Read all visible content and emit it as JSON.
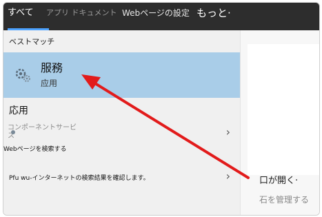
{
  "tabs": {
    "all": "すべて",
    "apps": "アプリ ドキュメント",
    "web": "Webページの設定",
    "more": "もっと·"
  },
  "sections": {
    "best_match": "ベストマッチ",
    "apps": "応用"
  },
  "best_match": {
    "title": "服務",
    "subtitle": "应用",
    "icon": "gear-icon"
  },
  "results": {
    "control_panel": "コンポーネントサービス",
    "web_search": "Webページを検索する",
    "pfu": "Pfu wu-インターネットの検索結果を確認します。"
  },
  "right_panel": {
    "open": "口が開く·",
    "manage": "石を管理する"
  },
  "colors": {
    "highlight": "#a9cde8",
    "tab_accent": "#4da3ff",
    "annotation_arrow": "#e21b1b"
  }
}
